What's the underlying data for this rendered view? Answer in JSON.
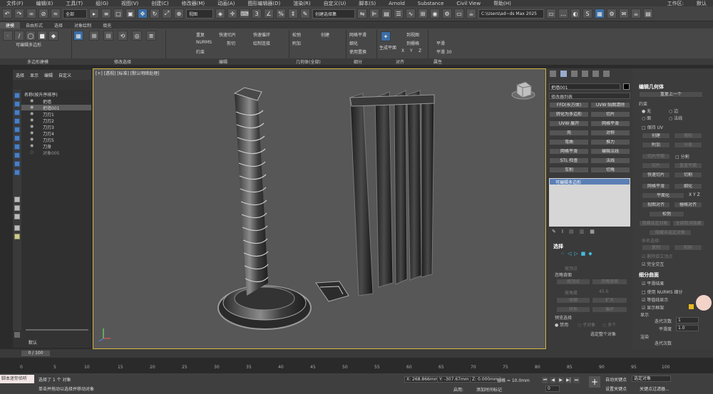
{
  "menu": [
    "文件(F)",
    "编辑(E)",
    "工具(T)",
    "组(G)",
    "视图(V)",
    "创建(C)",
    "修改器(M)",
    "动画(A)",
    "图形编辑器(D)",
    "渲染(R)",
    "自定义(U)",
    "脚本(S)",
    "Arnold",
    "Substance",
    "Civil View",
    "帮助(H)"
  ],
  "menu_right": [
    "工作区:",
    "默认"
  ],
  "toolbar": {
    "filter": "全部",
    "view": "视图",
    "selection_set": "创建选择集",
    "path": "C:\\Users\\ad~ds Max 2025"
  },
  "ribbon_tabs": [
    "建模",
    "自由形式",
    "选择",
    "对象绘制",
    "填充"
  ],
  "ribbon": {
    "poly_label": "可编辑多边形",
    "cmds": [
      "重复",
      "快速切片",
      "快速循环",
      "NURMS",
      "剪切",
      "约束",
      "绘制连接",
      "松弛",
      "创建",
      "附加",
      "网格平滑",
      "细化",
      "使用置换",
      "生成平面",
      "到视图",
      "到栅格",
      "X",
      "Y",
      "Z",
      "平滑",
      "平滑 30"
    ],
    "group_labels": [
      "多边形建模",
      "修改选择",
      "编辑",
      "几何体(全部)",
      "细分",
      "对齐",
      "属性"
    ]
  },
  "scene_explorer": {
    "tabs": [
      "选择",
      "显示",
      "编辑",
      "自定义"
    ],
    "header": "名称(按升序排序)",
    "items": [
      "把墙",
      "把墙001",
      "刀刃1",
      "刀刃2",
      "刀刃3",
      "刀刃4",
      "刀刃5",
      "刀身",
      "对象005"
    ],
    "selected_index": 1,
    "bottom_label": "默认"
  },
  "viewport": {
    "label": "[+] [透视] [标准] [默认明暗处理]"
  },
  "command_panel": {
    "object_name": "把墙001",
    "modifier_list": "修改器列表",
    "buttons": [
      "FFD(长方体)",
      "UVW 贴图清除",
      "转化为多边形",
      "切片",
      "UVW 展开",
      "网格平滑",
      "壳",
      "对称",
      "弯曲",
      "推力",
      "网格平滑",
      "编辑法线",
      "STL 检查",
      "法线",
      "车削",
      "切角"
    ],
    "stack_item": "可编辑多边形",
    "selection": {
      "title": "选择",
      "by_vertex": "按顶点",
      "ignore_back": "忽略背面",
      "by_angle": "按角度",
      "angle_value": "45.0",
      "shrink": "收缩",
      "grow": "扩大",
      "ring": "环形",
      "loop": "循环",
      "preview": "预览选择",
      "disabled": "禁用",
      "sub_obj": "子对象",
      "multi": "多个",
      "whole_obj": "选定整个对象"
    }
  },
  "edit_geometry": {
    "title": "编辑几何体",
    "repeat_last": "重复上一个",
    "constraints": "约束",
    "none": "无",
    "edge": "边",
    "face": "面",
    "normal": "法线",
    "preserve_uv": "保持 UV",
    "create": "创建",
    "collapse": "塌陷",
    "attach": "附加",
    "detach": "分离",
    "slice_plane": "切片平面",
    "split": "分割",
    "slice": "切片",
    "reset_plane": "重置平面",
    "quickslice": "快速切片",
    "cut": "切割",
    "meshsmooth": "网格平滑",
    "tessellate": "细化",
    "planarize": "平面化",
    "view_align": "视图对齐",
    "grid_align": "栅格对齐",
    "relax": "松弛",
    "hide_sel": "隐藏选定对象",
    "unhide_all": "全部取消隐藏",
    "hide_unsel": "隐藏未选定对象",
    "named_sel": "命名选择:",
    "copy": "复制",
    "paste": "粘贴",
    "delete_iso": "删除孤立顶点",
    "full_interactivity": "完全交互"
  },
  "subdivision": {
    "title": "细分曲面",
    "smooth_result": "平滑结果",
    "use_nurms": "使用 NURMS 细分",
    "isoline": "等值线显示",
    "show_cage": "显示框架",
    "display": "显示",
    "iterations": "迭代次数",
    "iterations_value": "1",
    "smoothness": "平滑度",
    "smoothness_value": "1.0",
    "render": "渲染",
    "render_iterations": "迭代次数"
  },
  "timeline": {
    "slider": "0 / 100",
    "ticks": [
      "0",
      "5",
      "10",
      "15",
      "20",
      "25",
      "30",
      "35",
      "40",
      "45",
      "50",
      "55",
      "60",
      "65",
      "70",
      "75",
      "80",
      "85",
      "90",
      "95",
      "100"
    ]
  },
  "status": {
    "script_label": "脚本迷你侦听",
    "selected": "选择了 1 个 对象",
    "hint": "单击并拖动以选择并移动对象",
    "x": "X: 268.866mm",
    "y": "Y: -307.67mm",
    "z": "Z: 0.000mm",
    "grid": "栅格 = 10.0mm",
    "enabled": "启用:",
    "add_key": "添加时间标记",
    "auto_key": "自动关键点",
    "set_key": "设置关键点",
    "selected_obj": "选定对象",
    "key_filters": "关键点过滤器...",
    "frame": "0"
  }
}
